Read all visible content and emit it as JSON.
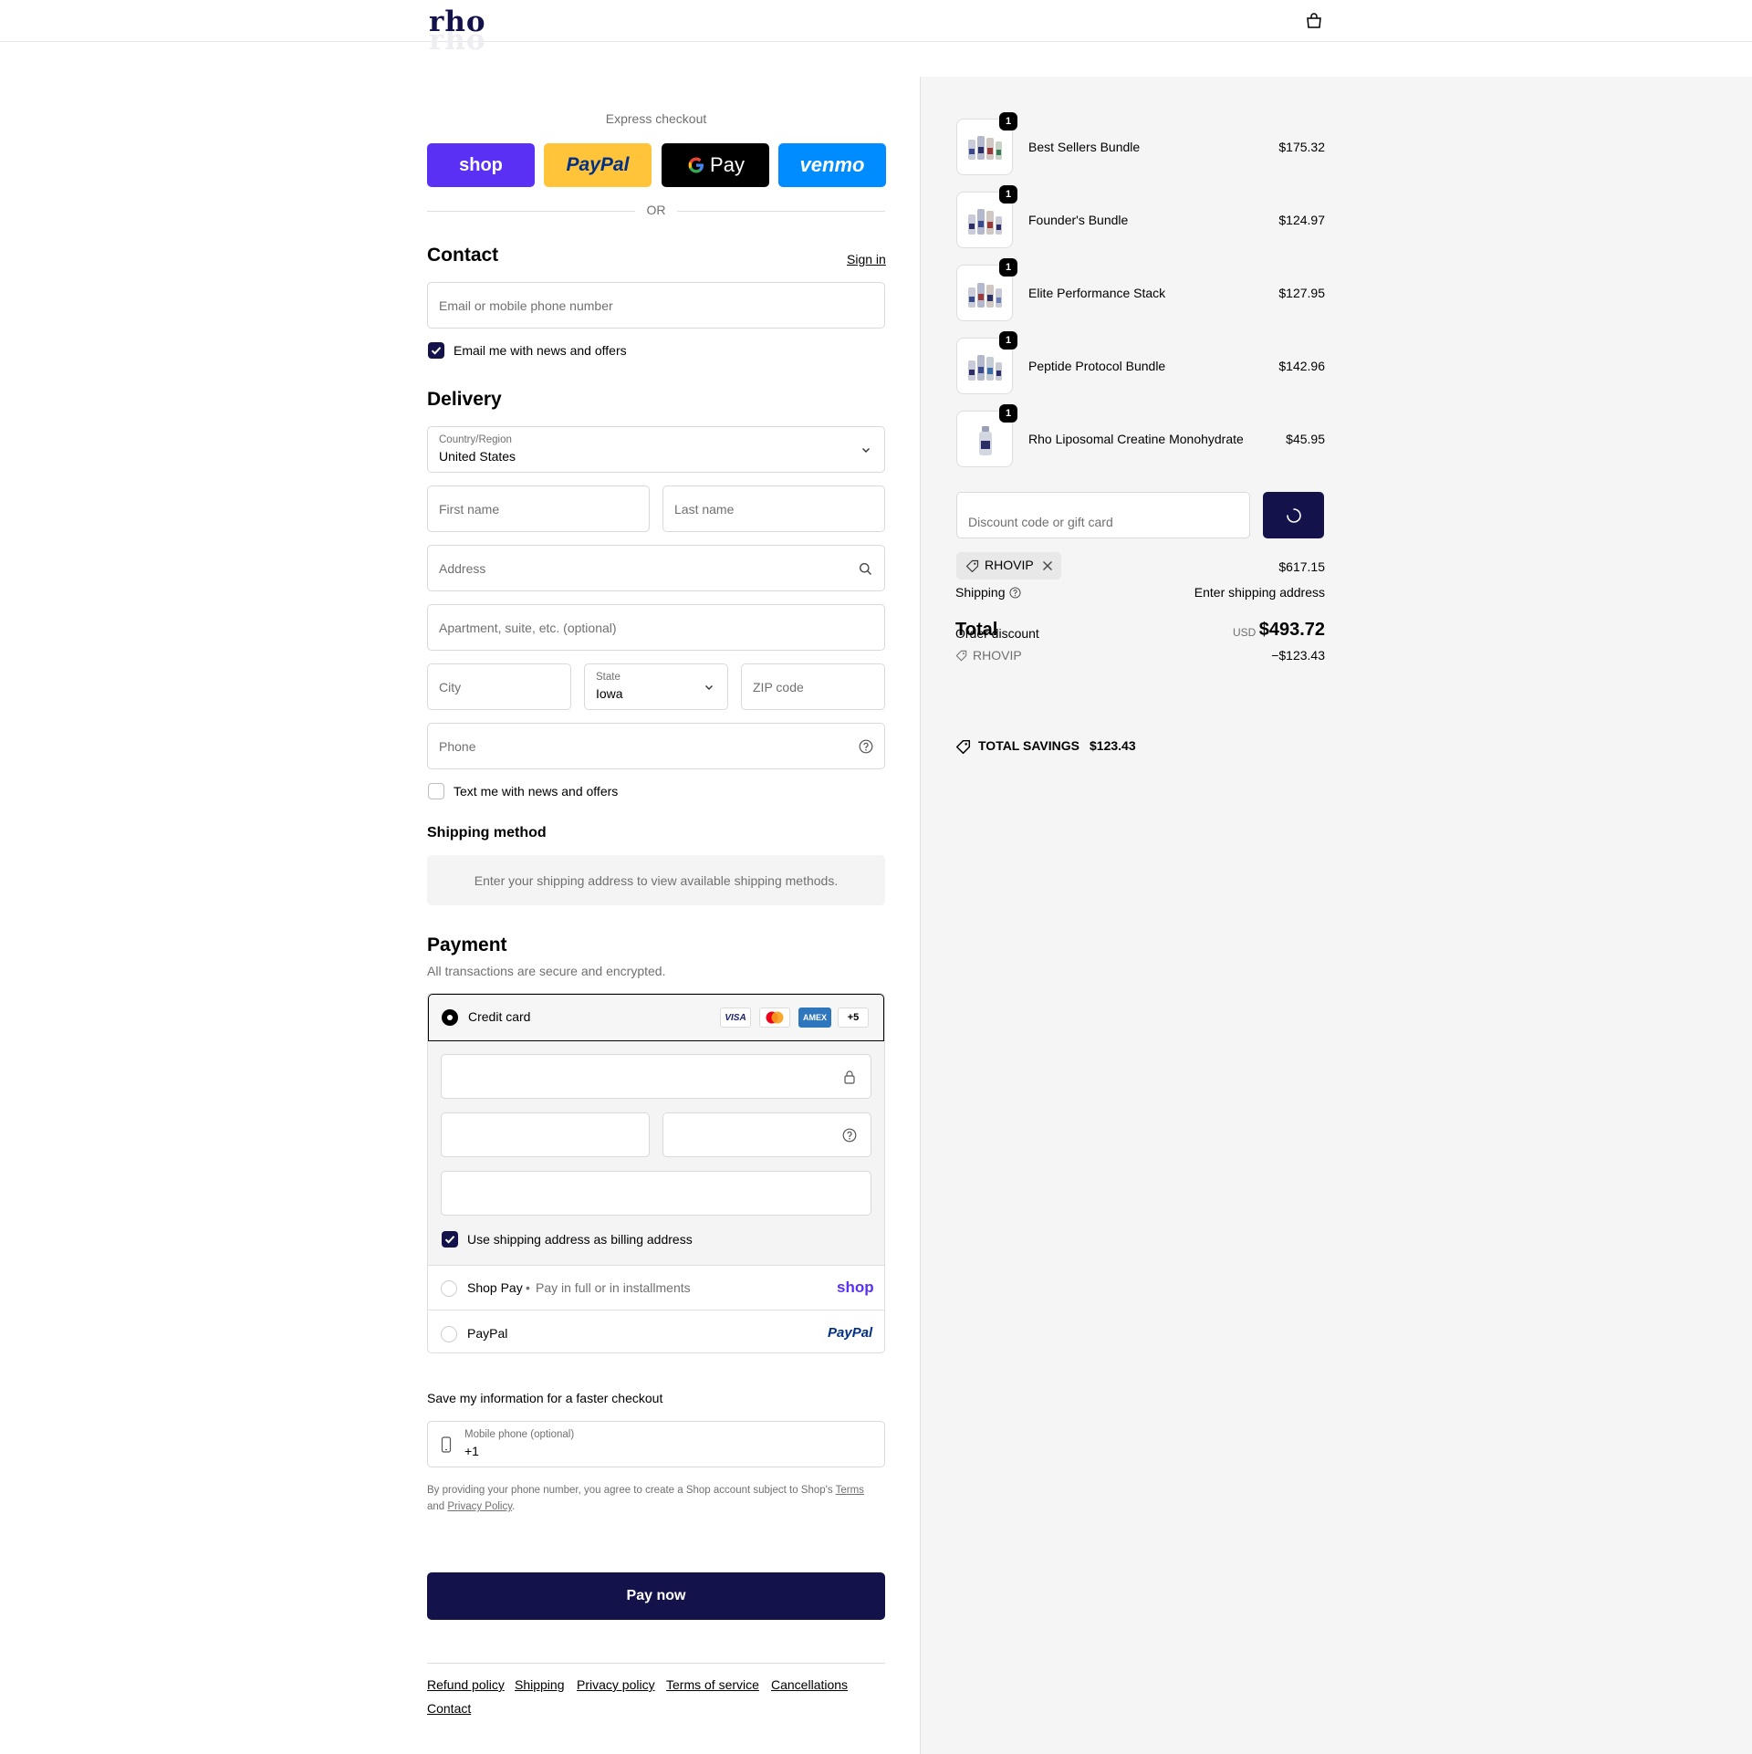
{
  "header": {
    "logo": "rho",
    "cart_icon": "bag-icon"
  },
  "express": {
    "title": "Express checkout",
    "buttons": [
      {
        "label": "shop",
        "bg": "#5a31f4",
        "color": "#ffffff"
      },
      {
        "label": "PayPal",
        "bg": "#ffc439",
        "color": "#003087"
      },
      {
        "label": "Pay",
        "bg": "#000000",
        "color": "#ffffff"
      },
      {
        "label": "venmo",
        "bg": "#008cff",
        "color": "#ffffff"
      }
    ],
    "or": "OR"
  },
  "contact": {
    "title": "Contact",
    "sign_in": "Sign in",
    "email_placeholder": "Email or mobile phone number",
    "news_label": "Email me with news and offers",
    "news_checked": true
  },
  "delivery": {
    "title": "Delivery",
    "country_label": "Country/Region",
    "country_value": "United States",
    "first_name": "First name",
    "last_name": "Last name",
    "address": "Address",
    "apartment": "Apartment, suite, etc. (optional)",
    "city": "City",
    "state_label": "State",
    "state_value": "Iowa",
    "zip": "ZIP code",
    "phone": "Phone",
    "text_label": "Text me with news and offers",
    "text_checked": false
  },
  "shipping_method": {
    "title": "Shipping method",
    "message": "Enter your shipping address to view available shipping methods."
  },
  "payment": {
    "title": "Payment",
    "subtitle": "All transactions are secure and encrypted.",
    "credit_card_label": "Credit card",
    "cards": [
      "VISA",
      "",
      "AMEX",
      "+5"
    ],
    "billing_label": "Use shipping address as billing address",
    "shop_pay_label": "Shop Pay",
    "shop_pay_desc": "Pay in full or in installments",
    "shop_pay_logo": "shop",
    "paypal_label": "PayPal",
    "paypal_logo": "PayPal"
  },
  "save_info": {
    "title": "Save my information for a faster checkout",
    "phone_label": "Mobile phone (optional)",
    "phone_value": "+1",
    "legal_1": "By providing your phone number, you agree to create a Shop account subject to Shop's",
    "terms": "Terms",
    "legal_and": "and",
    "privacy": "Privacy Policy",
    "legal_end": "."
  },
  "pay_now": "Pay now",
  "footer_links": [
    "Refund policy",
    "Shipping",
    "Privacy policy",
    "Terms of service",
    "Cancellations",
    "Contact"
  ],
  "order": {
    "items": [
      {
        "name": "Best Sellers Bundle",
        "price": "$175.32",
        "qty": "1"
      },
      {
        "name": "Founder's Bundle",
        "price": "$124.97",
        "qty": "1"
      },
      {
        "name": "Elite Performance Stack",
        "price": "$127.95",
        "qty": "1"
      },
      {
        "name": "Peptide Protocol Bundle",
        "price": "$142.96",
        "qty": "1"
      },
      {
        "name": "Rho Liposomal Creatine Monohydrate",
        "price": "$45.95",
        "qty": "1"
      }
    ],
    "discount_placeholder": "Discount code or gift card",
    "applied_code": "RHOVIP",
    "subtotal": "$617.15",
    "shipping_label": "Shipping",
    "shipping_value": "Enter shipping address",
    "total_label": "Total",
    "order_discount_label": "Order discount",
    "currency": "USD",
    "total_value": "$493.72",
    "discount_code": "RHOVIP",
    "discount_value": "−$123.43",
    "savings_label": "TOTAL SAVINGS",
    "savings_value": "$123.43"
  }
}
